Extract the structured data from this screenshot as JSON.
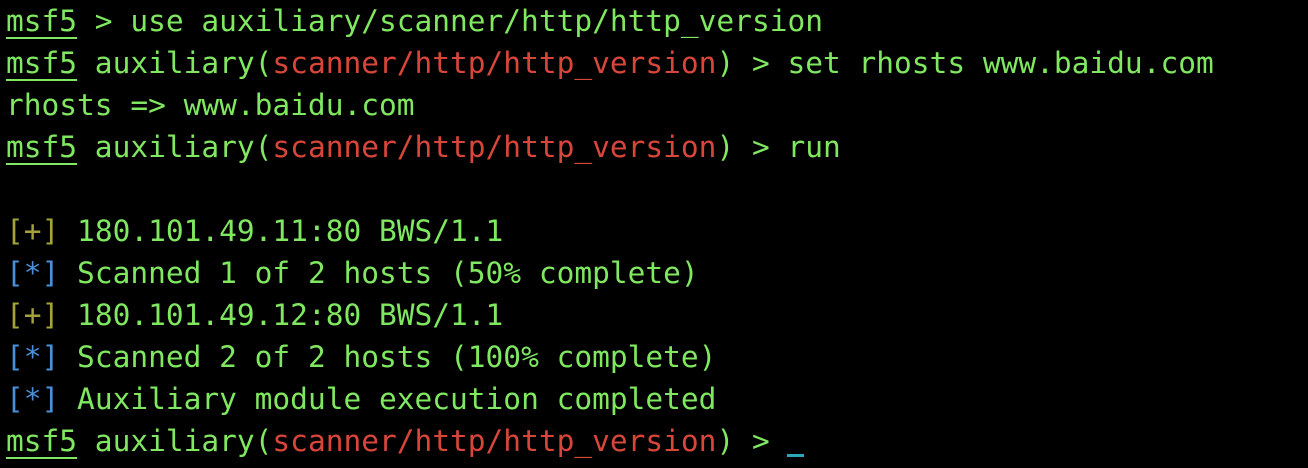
{
  "terminal": {
    "colors": {
      "green": "#80e860",
      "red": "#d8463a",
      "olive": "#a3a33a",
      "blue": "#4a8fd8",
      "cursor": "#2aa7b8"
    },
    "lines": [
      [
        {
          "t": "msf5",
          "c": "g",
          "u": true
        },
        {
          "t": " > use auxiliary/scanner/http/http_version",
          "c": "g"
        }
      ],
      [
        {
          "t": "msf5",
          "c": "g",
          "u": true
        },
        {
          "t": " auxiliary(",
          "c": "g"
        },
        {
          "t": "scanner/http/http_version",
          "c": "r"
        },
        {
          "t": ") > set rhosts www.baidu.com",
          "c": "g"
        }
      ],
      [
        {
          "t": "rhosts => www.baidu.com",
          "c": "g"
        }
      ],
      [
        {
          "t": "msf5",
          "c": "g",
          "u": true
        },
        {
          "t": " auxiliary(",
          "c": "g"
        },
        {
          "t": "scanner/http/http_version",
          "c": "r"
        },
        {
          "t": ") > run",
          "c": "g"
        }
      ],
      [],
      [
        {
          "t": "[+]",
          "c": "y"
        },
        {
          "t": " 180.101.49.11:80 BWS/1.1",
          "c": "g"
        }
      ],
      [
        {
          "t": "[*]",
          "c": "b"
        },
        {
          "t": " Scanned 1 of 2 hosts (50% complete)",
          "c": "g"
        }
      ],
      [
        {
          "t": "[+]",
          "c": "y"
        },
        {
          "t": " 180.101.49.12:80 BWS/1.1",
          "c": "g"
        }
      ],
      [
        {
          "t": "[*]",
          "c": "b"
        },
        {
          "t": " Scanned 2 of 2 hosts (100% complete)",
          "c": "g"
        }
      ],
      [
        {
          "t": "[*]",
          "c": "b"
        },
        {
          "t": " Auxiliary module execution completed",
          "c": "g"
        }
      ],
      [
        {
          "t": "msf5",
          "c": "g",
          "u": true
        },
        {
          "t": " auxiliary(",
          "c": "g"
        },
        {
          "t": "scanner/http/http_version",
          "c": "r"
        },
        {
          "t": ") > ",
          "c": "g"
        }
      ]
    ]
  }
}
